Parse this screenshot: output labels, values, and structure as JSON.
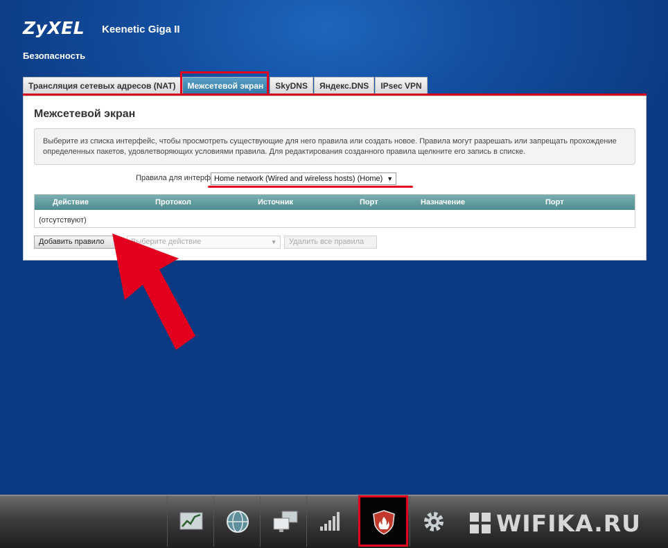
{
  "header": {
    "brand": "ZyXEL",
    "model": "Keenetic Giga II",
    "section": "Безопасность"
  },
  "tabs": [
    {
      "label": "Трансляция сетевых адресов (NAT)",
      "active": false
    },
    {
      "label": "Межсетевой экран",
      "active": true
    },
    {
      "label": "SkyDNS",
      "active": false
    },
    {
      "label": "Яндекс.DNS",
      "active": false
    },
    {
      "label": "IPsec VPN",
      "active": false
    }
  ],
  "panel": {
    "title": "Межсетевой экран",
    "info": "Выберите из списка интерфейс, чтобы просмотреть существующие для него правила или создать новое. Правила могут разрешать или запрещать прохождение определенных пакетов, удовлетворяющих условиями правила. Для редактирования созданного правила щелкните его запись в списке.",
    "interface_label": "Правила для интерфейса:",
    "interface_value": "Home network (Wired and wireless hosts) (Home)",
    "table": {
      "columns": [
        "Действие",
        "Протокол",
        "Источник",
        "Порт",
        "Назначение",
        "Порт"
      ],
      "empty_text": "(отсутствуют)"
    },
    "add_rule_label": "Добавить правило",
    "action_placeholder": "Выберите действие",
    "delete_all_label": "Удалить все правила"
  },
  "bottom_nav": [
    {
      "name": "monitor",
      "icon": "chart-icon"
    },
    {
      "name": "internet",
      "icon": "globe-icon"
    },
    {
      "name": "home-network",
      "icon": "computers-icon"
    },
    {
      "name": "wifi",
      "icon": "signal-bars-icon"
    },
    {
      "name": "security",
      "icon": "shield-fire-icon",
      "active": true
    },
    {
      "name": "system",
      "icon": "gear-icon"
    }
  ],
  "watermark": "WIFIKA.RU",
  "colors": {
    "highlight": "#e3001e",
    "tab_active": "#2f78a6",
    "table_header": "#5f9a9c",
    "background": "#134e9f"
  }
}
